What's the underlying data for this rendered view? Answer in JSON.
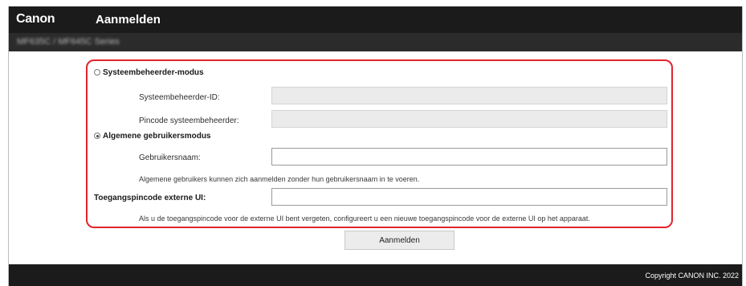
{
  "header": {
    "logo": "Canon",
    "title": "Aanmelden",
    "subbar_text": "MF635C / MF645C Series"
  },
  "form": {
    "admin_mode": {
      "label": "Systeembeheerder-modus",
      "selected": false,
      "id_label": "Systeembeheerder-ID:",
      "id_value": "",
      "pin_label": "Pincode systeembeheerder:",
      "pin_value": ""
    },
    "general_mode": {
      "label": "Algemene gebruikersmodus",
      "selected": true,
      "username_label": "Gebruikersnaam:",
      "username_value": "",
      "note": "Algemene gebruikers kunnen zich aanmelden zonder hun gebruikersnaam in te voeren."
    },
    "remote_pin": {
      "label": "Toegangspincode externe UI:",
      "value": "",
      "note": "Als u de toegangspincode voor de externe UI bent vergeten, configureert u een nieuwe toegangspincode voor de externe UI op het apparaat."
    },
    "submit_label": "Aanmelden"
  },
  "footer": {
    "copyright": "Copyright CANON INC. 2022"
  }
}
